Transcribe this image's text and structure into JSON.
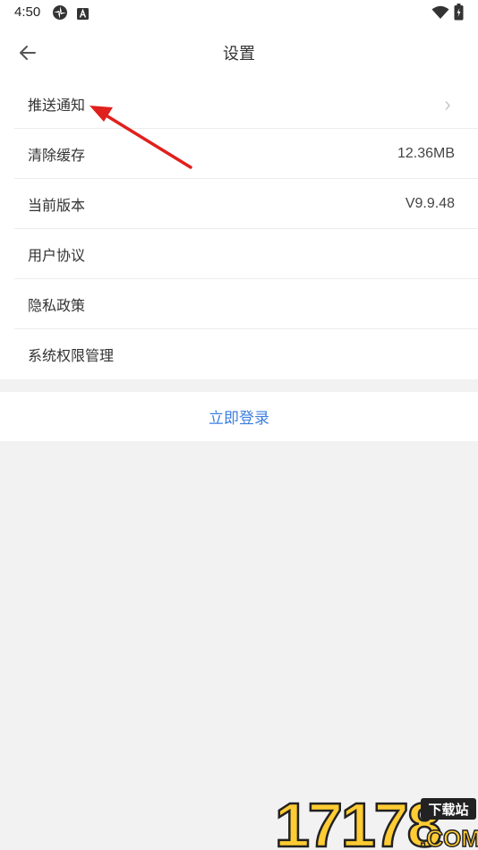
{
  "status_bar": {
    "time": "4:50",
    "icons": [
      "pinwheel-icon",
      "text-a-icon",
      "wifi-icon",
      "battery-icon"
    ]
  },
  "header": {
    "title": "设置",
    "back_icon": "arrow-left-icon"
  },
  "settings": {
    "items": [
      {
        "label": "推送通知",
        "value": "",
        "has_chevron": true
      },
      {
        "label": "清除缓存",
        "value": "12.36MB"
      },
      {
        "label": "当前版本",
        "value": "V9.9.48"
      },
      {
        "label": "用户协议",
        "value": ""
      },
      {
        "label": "隐私政策",
        "value": ""
      },
      {
        "label": "系统权限管理",
        "value": ""
      }
    ]
  },
  "login": {
    "label": "立即登录"
  },
  "watermark": {
    "brand_digits": "17178",
    "tag": "下载站",
    "domain": ".COM"
  },
  "colors": {
    "accent": "#3d7fe0",
    "background": "#f2f2f2",
    "annotation_arrow": "#e0201c"
  }
}
